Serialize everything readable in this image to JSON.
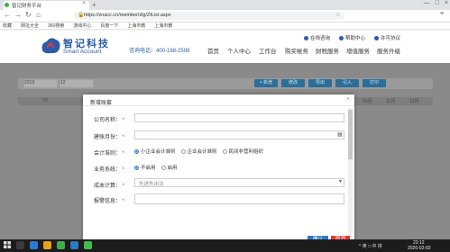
{
  "browser": {
    "tab_title": "智记财务平台",
    "url": "https://znacc.cn/member/zlg/ZtList.aspx",
    "bookmarks": [
      "收藏",
      "网址大全",
      "360搜索",
      "游戏中心",
      "百度一下",
      "上海市教",
      "上海市教"
    ]
  },
  "site": {
    "logo_cn": "智记科技",
    "logo_en": "Smart  Account",
    "hotline": "咨询电话：400-168-2508",
    "nav": [
      "首页",
      "个人中心",
      "工作台",
      "购买帐务",
      "财税服务",
      "增值服务",
      "服务升级"
    ],
    "top_links": [
      "在线咨询",
      "帮助中心",
      "许可协议"
    ]
  },
  "toolbar": {
    "year": "2019",
    "month": "12",
    "buttons": [
      "+ 新增",
      "修改",
      "导出",
      "引入",
      "打印"
    ]
  },
  "table_headers": [
    "ID",
    "10月",
    "11月",
    "12月"
  ],
  "modal": {
    "title": "新增账套",
    "close": "×",
    "company_label": "公司名称：",
    "start_label": "建账月份：",
    "standard_label": "会计准则：",
    "standard_options": [
      "小企业会计准则",
      "企业会计准则",
      "民间非营利组织"
    ],
    "standard_selected": 0,
    "business_label": "业务系统：",
    "business_options": [
      "不启用",
      "启用"
    ],
    "business_selected": 0,
    "cost_label": "成本计算：",
    "cost_placeholder": "先进先出法",
    "report_label": "报警信息：",
    "confirm": "确认",
    "cancel": "取消"
  },
  "taskbar": {
    "tray": "^ 英 □ 中 拼",
    "time": "23:12",
    "date": "2020-02-02"
  },
  "colors": {
    "brand": "#2a5caa",
    "primary": "#2b78c5",
    "danger": "#e53935"
  }
}
